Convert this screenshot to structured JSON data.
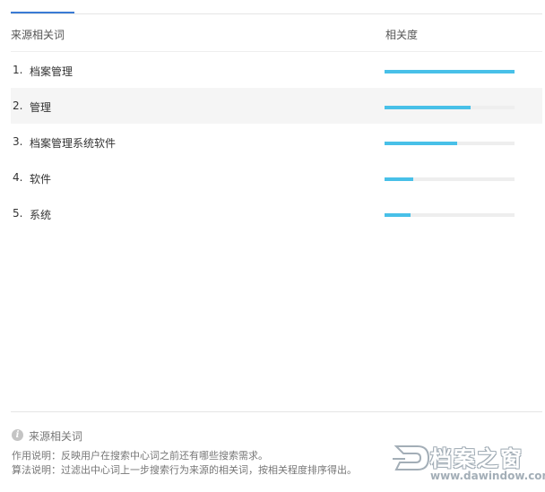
{
  "header": {
    "term_column": "来源相关词",
    "relevance_column": "相关度"
  },
  "rows": [
    {
      "num": "1.",
      "term": "档案管理",
      "relevance": 1.0
    },
    {
      "num": "2.",
      "term": "管理",
      "relevance": 0.66
    },
    {
      "num": "3.",
      "term": "档案管理系统软件",
      "relevance": 0.56
    },
    {
      "num": "4.",
      "term": "软件",
      "relevance": 0.22
    },
    {
      "num": "5.",
      "term": "系统",
      "relevance": 0.2
    }
  ],
  "footer": {
    "icon": "info-icon",
    "title": "来源相关词",
    "description": "作用说明：反映用户在搜索中心词之前还有哪些搜索需求。",
    "algorithm": "算法说明：过滤出中心词上一步搜索行为来源的相关词，按相关程度排序得出。"
  },
  "watermark": {
    "name": "档案之窗",
    "url": "www.dawindow.com"
  },
  "colors": {
    "accent": "#3a7bd5",
    "bar": "#48c0e8",
    "track": "#eeeeee",
    "highlight_row": "#f5f5f5"
  }
}
